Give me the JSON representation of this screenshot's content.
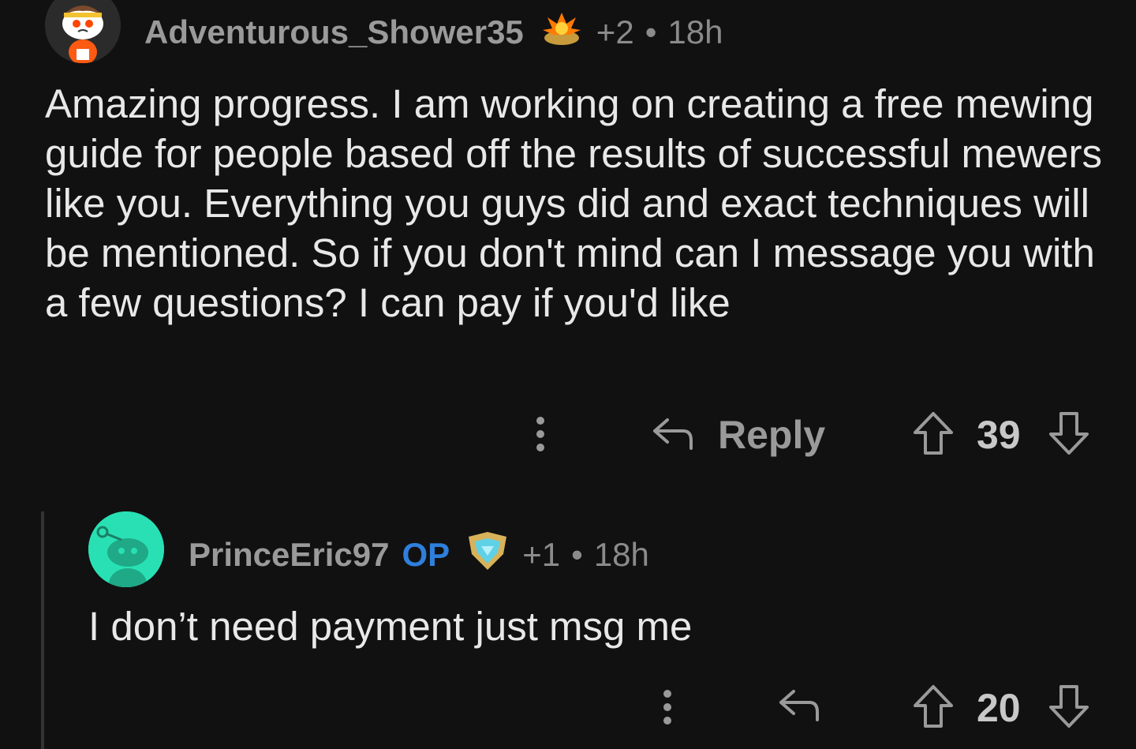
{
  "comments": [
    {
      "username": "Adventurous_Shower35",
      "award_count": "+2",
      "separator": "•",
      "age": "18h",
      "body": "Amazing progress. I am working on creating a free mewing guide for people based off the results of successful mewers like you. Everything you guys did and exact techniques will be mentioned. So if you don't mind can I message you with a few questions? I can pay if you'd like",
      "reply_label": "Reply",
      "score": "39"
    },
    {
      "username": "PrinceEric97",
      "op_badge": "OP",
      "award_count": "+1",
      "separator": "•",
      "age": "18h",
      "body": "I don’t need payment just msg me",
      "score": "20"
    }
  ],
  "icons": {
    "more": "kebab-icon",
    "reply": "reply-icon",
    "upvote": "upvote-icon",
    "downvote": "downvote-icon",
    "award1": "fire-award-icon",
    "award2": "gem-shield-award-icon"
  },
  "colors": {
    "background": "#111111",
    "op": "#2f7fdc",
    "avatar2": "#28e0b4",
    "text": "#e8e8e8",
    "meta": "#8b8b8b"
  }
}
